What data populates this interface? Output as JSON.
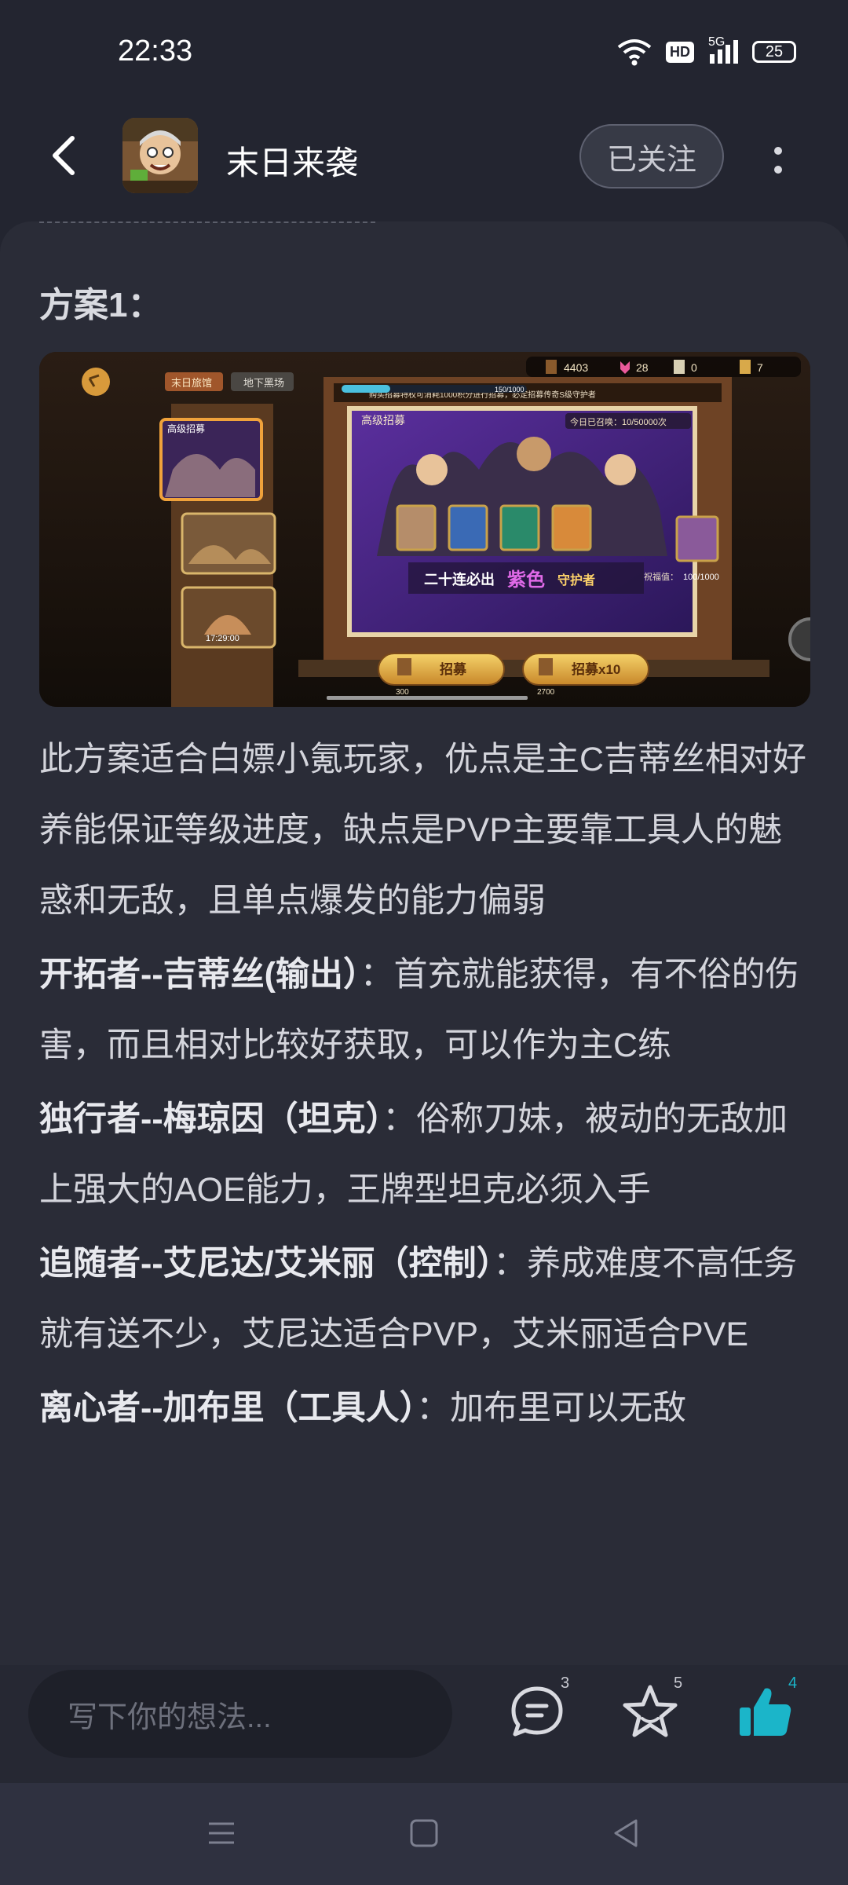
{
  "status_bar": {
    "time": "22:33",
    "hd": "HD",
    "network": "5G",
    "battery": "25"
  },
  "header": {
    "author_name": "末日来袭",
    "follow_label": "已关注"
  },
  "section_title": "方案1：",
  "screenshot": {
    "currency_1": "4403",
    "currency_2": "28",
    "currency_3": "0",
    "currency_4": "7",
    "tab_1": "末日旅馆",
    "tab_2": "地下黑场",
    "banner_top": "高级招募",
    "notice": "购买招募特权可消耗1000积分进行招募，必定招募传奇S级守护者",
    "progress": "150/1000",
    "today_count": "今日已召唤：10/50000次",
    "slogan_a": "二十连必出",
    "slogan_b": "紫色",
    "slogan_c": "守护者",
    "bless": "祝福值：",
    "bless_val": "100/1000",
    "timer": "17:29:00",
    "recruit_1": "招募",
    "recruit_1_cost": "300",
    "recruit_10": "招募x10",
    "recruit_10_cost": "2700",
    "side_label_1": "高级招募"
  },
  "paragraphs": {
    "intro": "此方案适合白嫖小氪玩家，优点是主C吉蒂丝相对好养能保证等级进度，缺点是PVP主要靠工具人的魅惑和无敌，且单点爆发的能力偏弱",
    "h1_title": "开拓者--吉蒂丝(输出）",
    "h1_body": "：首充就能获得，有不俗的伤害，而且相对比较好获取，可以作为主C练",
    "h2_title": "独行者--梅琼因（坦克）",
    "h2_body": "：俗称刀妹，被动的无敌加上强大的AOE能力，王牌型坦克必须入手",
    "h3_title": "追随者--艾尼达/艾米丽（控制）",
    "h3_body": "：养成难度不高任务就有送不少，艾尼达适合PVP，艾米丽适合PVE",
    "h4_title": "离心者--加布里（工具人）",
    "h4_body": "：加布里可以无敌"
  },
  "bottom_bar": {
    "comment_placeholder": "写下你的想法...",
    "comment_count": "3",
    "favorite_count": "5",
    "like_count": "4"
  },
  "colors": {
    "accent": "#1bb5c9",
    "background": "#232530",
    "card": "#2a2c37"
  }
}
